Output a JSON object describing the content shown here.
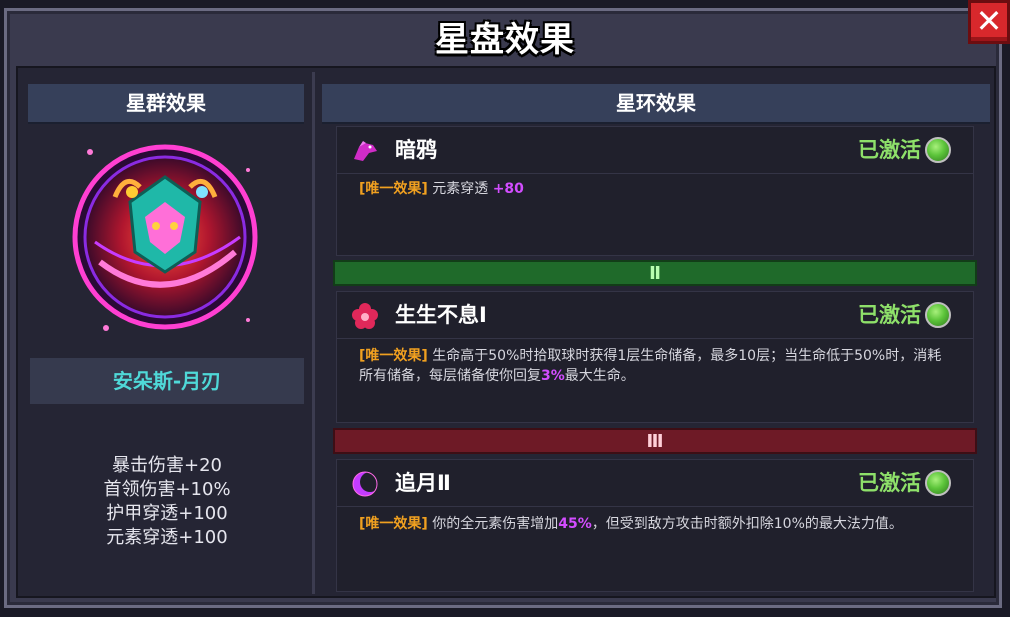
{
  "window": {
    "title": "星盘效果",
    "close_label": "✕"
  },
  "left_panel": {
    "header": "星群效果",
    "constellation_name": "安朵斯-月刃",
    "stats": [
      "暴击伤害+20",
      "首领伤害+10%",
      "护甲穿透+100",
      "元素穿透+100"
    ]
  },
  "right_panel": {
    "header": "星环效果",
    "rings": [
      {
        "name": "暗鸦",
        "icon": "crow-icon",
        "status": "已激活",
        "tag": "[唯一效果]",
        "desc_parts": [
          "元素穿透 ",
          "+80",
          ""
        ]
      },
      {
        "name": "生生不息Ⅰ",
        "icon": "flower-icon",
        "status": "已激活",
        "tag": "[唯一效果]",
        "desc_parts": [
          "生命高于50%时拾取球时获得1层生命储备，最多10层；当生命低于50%时，消耗所有储备，每层储备使你回复",
          "3%",
          "最大生命。"
        ]
      },
      {
        "name": "追月Ⅱ",
        "icon": "crescent-moon-icon",
        "status": "已激活",
        "tag": "[唯一效果]",
        "desc_parts": [
          "你的全元素伤害增加",
          "45%",
          "，但受到敌方攻击时额外扣除10%的最大法力值。"
        ]
      }
    ],
    "dividers": [
      "Ⅱ",
      "Ⅲ"
    ]
  },
  "colors": {
    "active_green": "#8ee06a",
    "tag_orange": "#f0a020",
    "highlight_purple": "#d24dff",
    "name_cyan": "#4fd8d8"
  }
}
